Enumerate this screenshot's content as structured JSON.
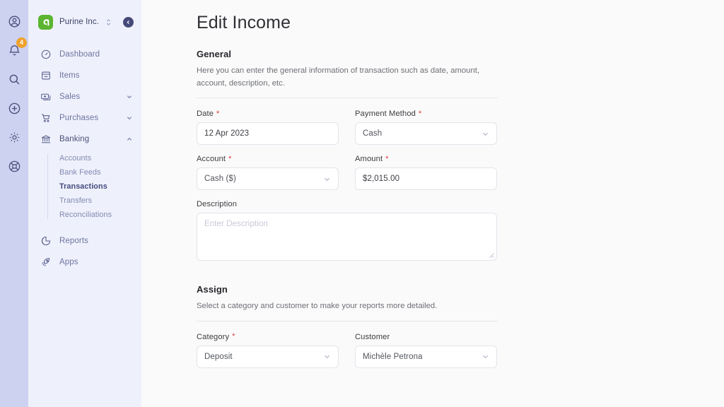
{
  "rail": {
    "items": [
      {
        "name": "account-icon",
        "badge": null
      },
      {
        "name": "notifications-icon",
        "badge": "4"
      },
      {
        "name": "search-icon",
        "badge": null
      },
      {
        "name": "add-icon",
        "badge": null
      },
      {
        "name": "settings-icon",
        "badge": null
      },
      {
        "name": "help-icon",
        "badge": null
      }
    ]
  },
  "sidebar": {
    "company": "Purine Inc.",
    "logo_color": "#5cb531",
    "nav": [
      {
        "label": "Dashboard",
        "icon": "dashboard-icon",
        "chevron": null
      },
      {
        "label": "Items",
        "icon": "items-icon",
        "chevron": null
      },
      {
        "label": "Sales",
        "icon": "sales-icon",
        "chevron": "down"
      },
      {
        "label": "Purchases",
        "icon": "purchases-icon",
        "chevron": "down"
      },
      {
        "label": "Banking",
        "icon": "banking-icon",
        "chevron": "up"
      }
    ],
    "submenu": [
      {
        "label": "Accounts",
        "active": false
      },
      {
        "label": "Bank Feeds",
        "active": false
      },
      {
        "label": "Transactions",
        "active": true
      },
      {
        "label": "Transfers",
        "active": false
      },
      {
        "label": "Reconciliations",
        "active": false
      }
    ],
    "nav_bottom": [
      {
        "label": "Reports",
        "icon": "reports-icon"
      },
      {
        "label": "Apps",
        "icon": "apps-icon"
      }
    ]
  },
  "main": {
    "title": "Edit Income",
    "general": {
      "heading": "General",
      "description": "Here you can enter the general information of transaction such as date, amount, account, description, etc.",
      "fields": {
        "date": {
          "label": "Date",
          "required": true,
          "value": "12 Apr 2023"
        },
        "payment_method": {
          "label": "Payment Method",
          "required": true,
          "value": "Cash"
        },
        "account": {
          "label": "Account",
          "required": true,
          "value": "Cash ($)"
        },
        "amount": {
          "label": "Amount",
          "required": true,
          "value": "$2,015.00"
        },
        "description": {
          "label": "Description",
          "required": false,
          "value": "",
          "placeholder": "Enter Description"
        }
      }
    },
    "assign": {
      "heading": "Assign",
      "description": "Select a category and customer to make your reports more detailed.",
      "fields": {
        "category": {
          "label": "Category",
          "required": true,
          "value": "Deposit"
        },
        "customer": {
          "label": "Customer",
          "required": false,
          "value": "Michèle Petrona"
        }
      }
    }
  }
}
